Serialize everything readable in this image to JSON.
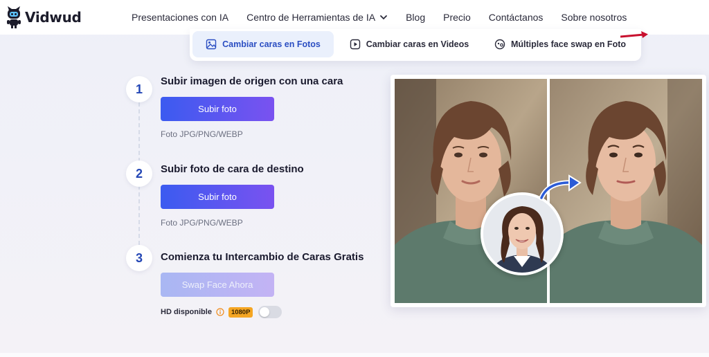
{
  "header": {
    "brand": "Vidwud",
    "nav": [
      {
        "label": "Presentaciones con IA"
      },
      {
        "label": "Centro de Herramientas de IA"
      },
      {
        "label": "Blog"
      },
      {
        "label": "Precio"
      },
      {
        "label": "Contáctanos"
      },
      {
        "label": "Sobre nosotros"
      }
    ]
  },
  "tabs": [
    {
      "label": "Cambiar caras en Fotos",
      "icon": "image-icon",
      "active": true
    },
    {
      "label": "Cambiar caras en Videos",
      "icon": "play-icon",
      "active": false
    },
    {
      "label": "Múltiples face swap en Foto",
      "icon": "faces-icon",
      "active": false
    }
  ],
  "steps": [
    {
      "number": "1",
      "title": "Subir imagen de origen con una cara",
      "button": "Subir foto",
      "hint": "Foto JPG/PNG/WEBP"
    },
    {
      "number": "2",
      "title": "Subir foto de cara de destino",
      "button": "Subir foto",
      "hint": "Foto JPG/PNG/WEBP"
    },
    {
      "number": "3",
      "title": "Comienza tu Intercambio de Caras Gratis",
      "button": "Swap Face Ahora"
    }
  ],
  "hd": {
    "label": "HD disponible",
    "badge": "1080P",
    "enabled": false
  },
  "colors": {
    "accent": "#2b4ec2",
    "button_start": "#3b5bf0",
    "button_end": "#7a52f0",
    "badge": "#f5a623"
  }
}
